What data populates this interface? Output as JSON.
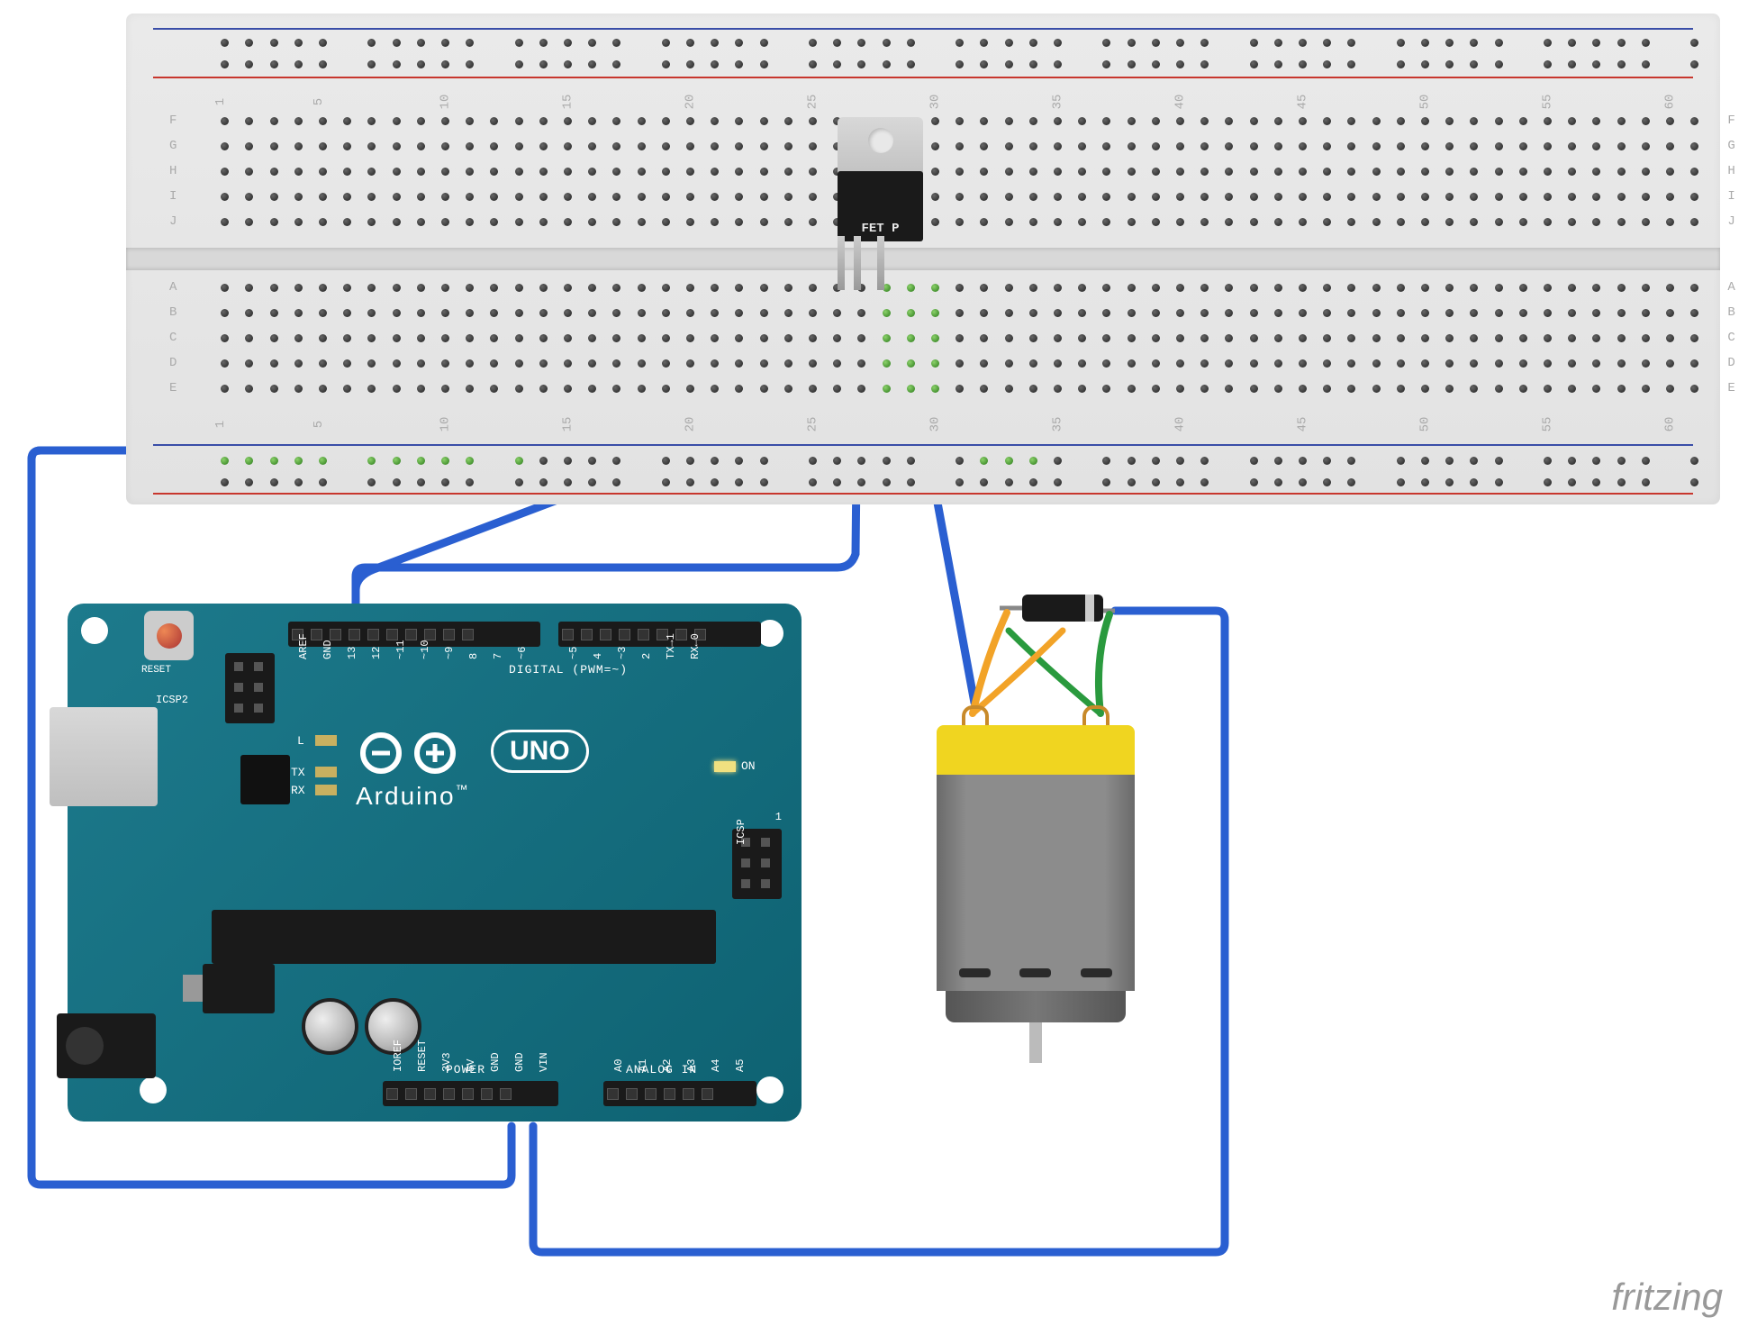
{
  "circuit": {
    "breadboard": {
      "type": "full-size solderless breadboard",
      "col_numbers": [
        1,
        5,
        10,
        15,
        20,
        25,
        30,
        35,
        40,
        45,
        50,
        55,
        60
      ],
      "row_labels_top": [
        "J",
        "I",
        "H",
        "G",
        "F"
      ],
      "row_labels_bottom": [
        "E",
        "D",
        "C",
        "B",
        "A"
      ],
      "rails": [
        "+",
        "-",
        "+",
        "-"
      ]
    },
    "arduino": {
      "model": "UNO",
      "brand": "Arduino",
      "tm": "™",
      "reset_label": "RESET",
      "icsp2_label": "ICSP2",
      "icsp_label": "ICSP",
      "digital_label": "DIGITAL (PWM=~)",
      "power_label": "POWER",
      "analog_label": "ANALOG IN",
      "led_labels": {
        "L": "L",
        "TX": "TX",
        "RX": "RX",
        "ON": "ON"
      },
      "digital_pins": [
        "AREF",
        "GND",
        "13",
        "12",
        "~11",
        "~10",
        "~9",
        "8",
        "7",
        "~6",
        "~5",
        "4",
        "~3",
        "2",
        "TX→1",
        "RX←0"
      ],
      "power_pins": [
        "IOREF",
        "RESET",
        "3V3",
        "5V",
        "GND",
        "GND",
        "VIN"
      ],
      "analog_pins": [
        "A0",
        "A1",
        "A2",
        "A3",
        "A4",
        "A5"
      ],
      "icsp_dot": "1"
    },
    "components": {
      "mosfet": {
        "label": "FET P",
        "package": "TO-220"
      },
      "diode": {
        "type": "flyback diode"
      },
      "motor": {
        "type": "DC brushed motor"
      }
    },
    "connections": [
      {
        "from": "arduino.GND(power)",
        "to": "breadboard.bottom_ground_rail",
        "color": "blue"
      },
      {
        "from": "arduino.VIN",
        "to": "motor.terminal_right_via_diode_cathode",
        "color": "blue"
      },
      {
        "from": "arduino.D12",
        "to": "mosfet.gate(col28)",
        "color": "blue"
      },
      {
        "from": "mosfet.drain(col29)",
        "to": "motor.terminal_left",
        "color": "blue"
      },
      {
        "from": "mosfet.source(col30)",
        "to": "breadboard.bottom_ground_rail",
        "color": "blue"
      },
      {
        "from": "motor.terminal_left",
        "to": "diode.anode",
        "color": "orange"
      },
      {
        "from": "motor.terminal_right",
        "to": "diode.cathode",
        "color": "green"
      }
    ]
  },
  "watermark": "fritzing"
}
